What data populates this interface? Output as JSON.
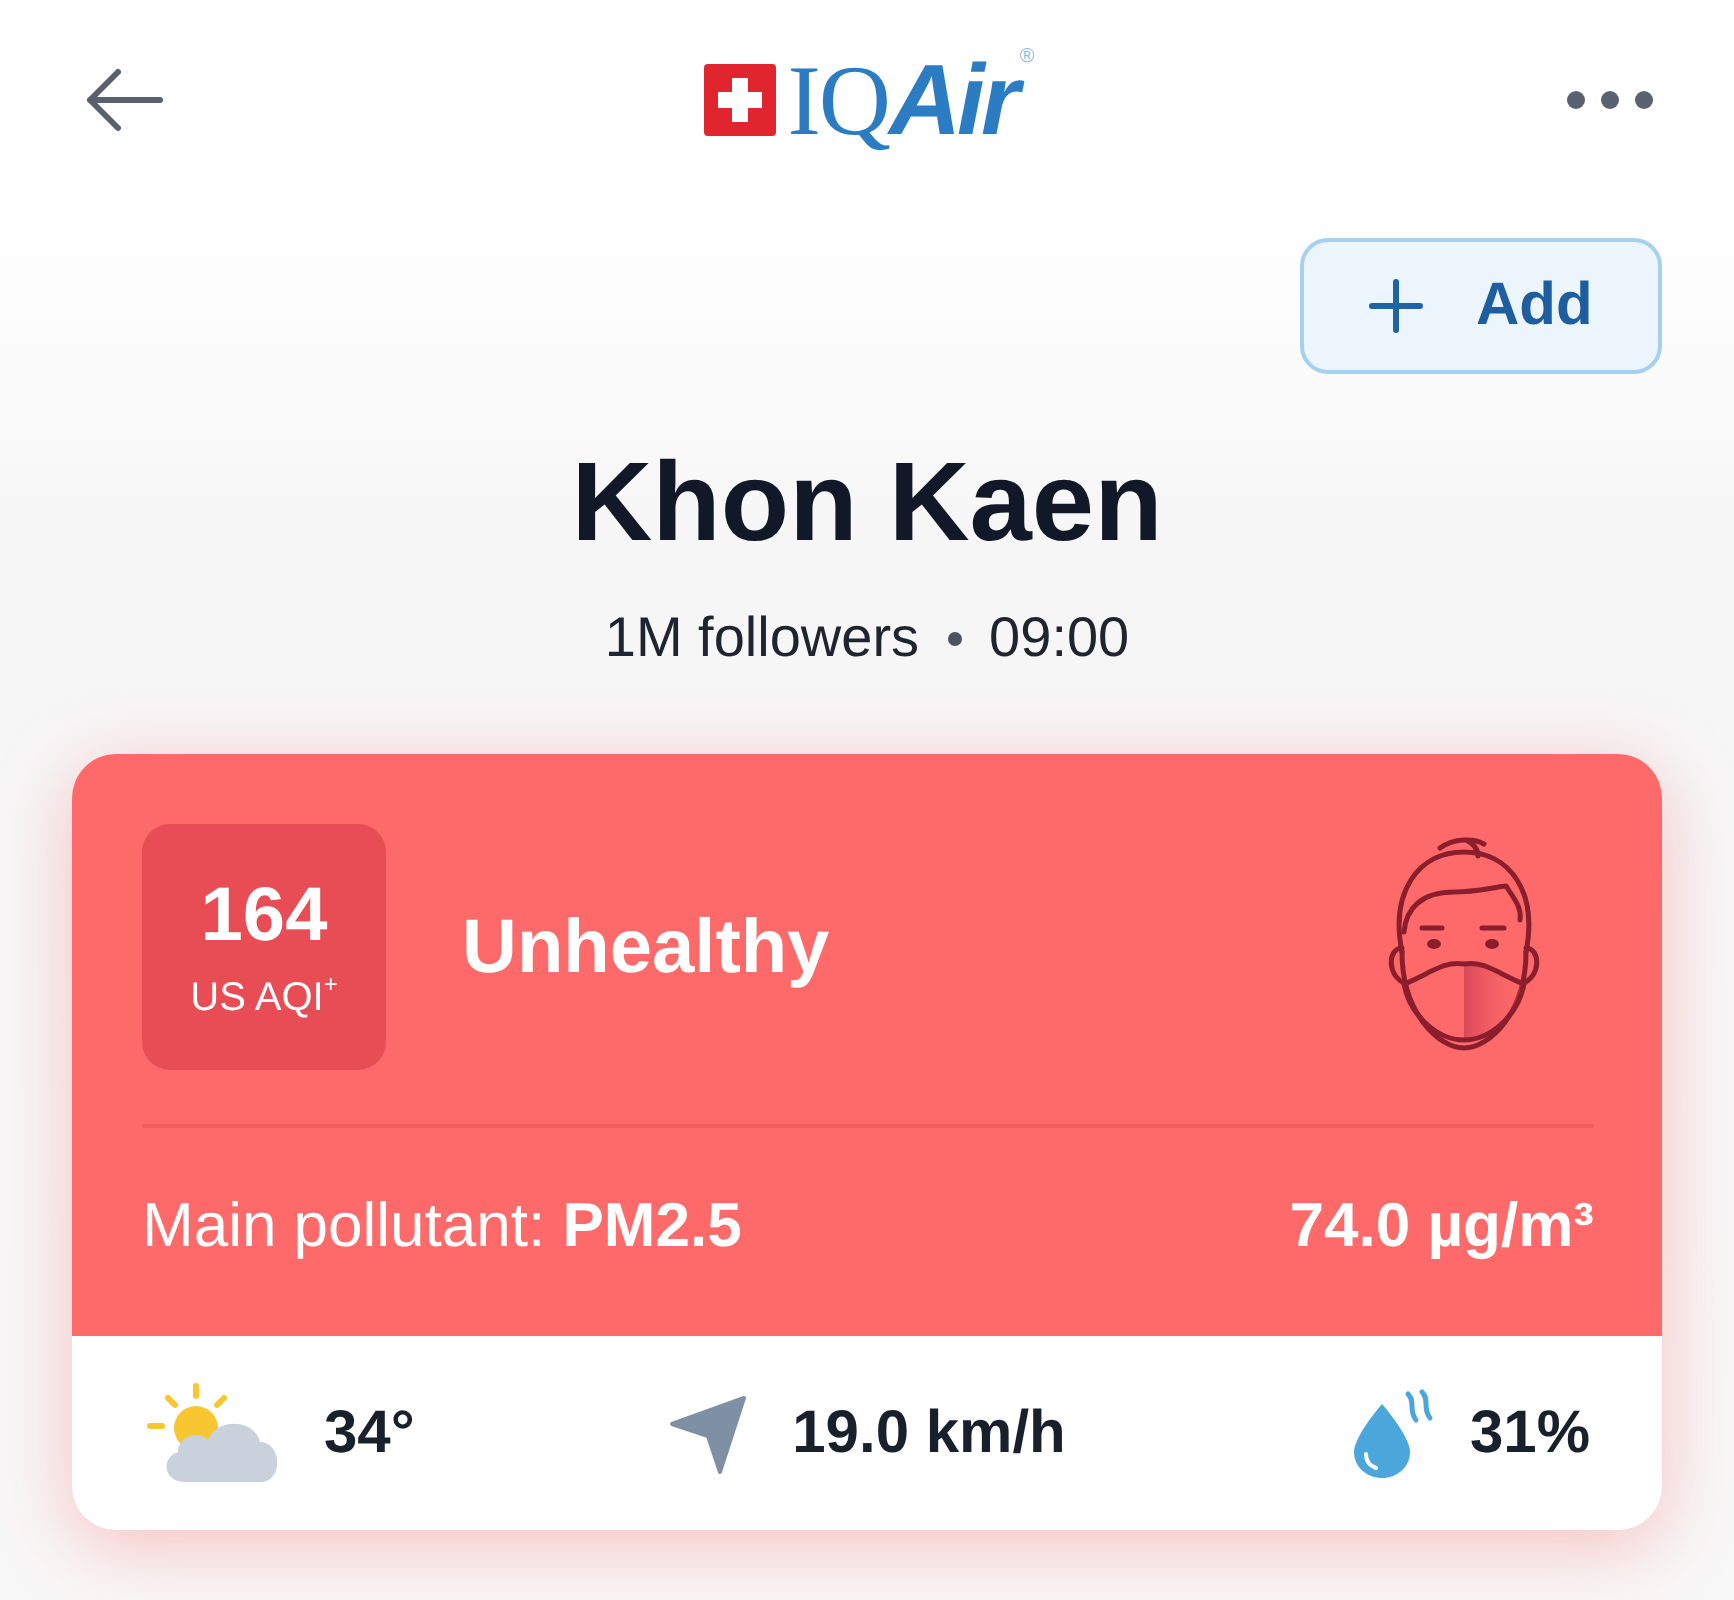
{
  "header": {
    "logo": {
      "plain_part": "IQ",
      "italic_part": "Air",
      "mark": "®"
    }
  },
  "add_button": {
    "label": "Add"
  },
  "location": {
    "name": "Khon Kaen",
    "followers": "1M followers",
    "time": "09:00"
  },
  "aqi_card": {
    "aqi": "164",
    "unit": "US AQI$^{+}$",
    "status": "Unhealthy",
    "main_pollutant": "Main pollutant: **PM2.5**",
    "concentration": "74.0 µg/m³"
  },
  "weather": [
    {
      "kind": "temperature",
      "value": "34°"
    },
    {
      "kind": "wind",
      "value": "19.0 km/h"
    },
    {
      "kind": "humidity",
      "value": "31%"
    }
  ]
}
